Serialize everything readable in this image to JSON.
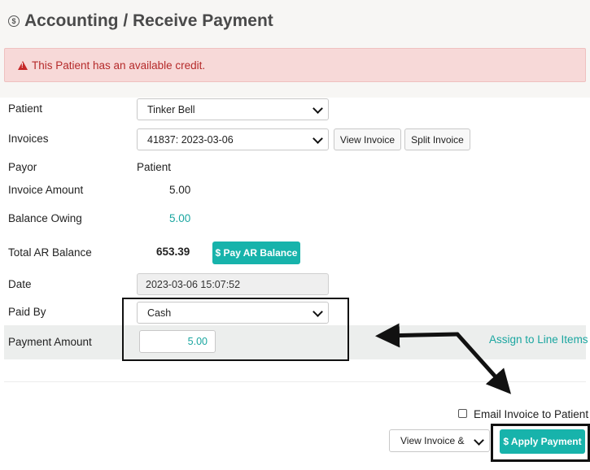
{
  "header": {
    "title": "Accounting / Receive Payment",
    "title_icon": "dollar-circle-icon"
  },
  "alert": {
    "text": "This Patient has an available credit.",
    "icon": "warning-icon",
    "color": "#c62828"
  },
  "form": {
    "patient": {
      "label": "Patient",
      "value": "Tinker Bell"
    },
    "invoices": {
      "label": "Invoices",
      "value": "41837: 2023-03-06",
      "view_button": "View Invoice",
      "split_button": "Split Invoice"
    },
    "payor": {
      "label": "Payor",
      "value": "Patient"
    },
    "invoice_amount": {
      "label": "Invoice Amount",
      "value": "5.00"
    },
    "balance_owing": {
      "label": "Balance Owing",
      "value": "5.00"
    },
    "total_ar": {
      "label": "Total AR Balance",
      "value": "653.39",
      "button": "$ Pay AR Balance"
    },
    "date": {
      "label": "Date",
      "value": "2023-03-06 15:07:52"
    },
    "paid_by": {
      "label": "Paid By",
      "value": "Cash"
    },
    "payment_amount": {
      "label": "Payment Amount",
      "value": "5.00",
      "assign_link": "Assign to Line Items"
    }
  },
  "footer": {
    "email_label": "Email Invoice to Patient",
    "email_checked": false,
    "view_invoice_select": "View Invoice &",
    "apply_button": "$ Apply Payment"
  },
  "colors": {
    "accent": "#17b3ab",
    "alert_bg": "#f7d9d8",
    "alert_text": "#b52a2a"
  }
}
